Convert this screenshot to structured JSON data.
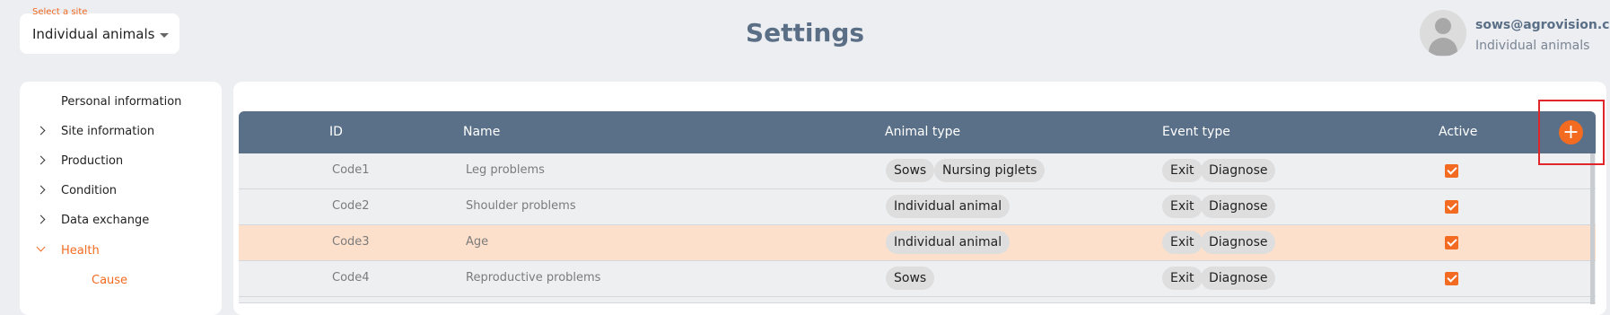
{
  "site_selector": {
    "label": "Select a site",
    "value": "Individual animals"
  },
  "page_title": "Settings",
  "user": {
    "email": "sows@agrovision.com",
    "site": "Individual animals"
  },
  "sidebar": {
    "items": [
      {
        "label": "Personal information",
        "expandable": false
      },
      {
        "label": "Site information",
        "expandable": true
      },
      {
        "label": "Production",
        "expandable": true
      },
      {
        "label": "Condition",
        "expandable": true
      },
      {
        "label": "Data exchange",
        "expandable": true
      },
      {
        "label": "Health",
        "expandable": true,
        "expanded": true,
        "active": true
      }
    ],
    "sub_item": "Cause"
  },
  "table": {
    "headers": {
      "id": "ID",
      "name": "Name",
      "animal_type": "Animal type",
      "event_type": "Event type",
      "active": "Active"
    },
    "rows": [
      {
        "id": "Code1",
        "name": "Leg problems",
        "animal_types": [
          "Sows",
          "Nursing piglets"
        ],
        "event_types": [
          "Exit",
          "Diagnose"
        ],
        "active": true
      },
      {
        "id": "Code2",
        "name": "Shoulder problems",
        "animal_types": [
          "Individual animal"
        ],
        "event_types": [
          "Exit",
          "Diagnose"
        ],
        "active": true
      },
      {
        "id": "Code3",
        "name": "Age",
        "animal_types": [
          "Individual animal"
        ],
        "event_types": [
          "Exit",
          "Diagnose"
        ],
        "active": true,
        "highlighted": true
      },
      {
        "id": "Code4",
        "name": "Reproductive problems",
        "animal_types": [
          "Sows"
        ],
        "event_types": [
          "Exit",
          "Diagnose"
        ],
        "active": true
      }
    ]
  },
  "add_button": {
    "label": "+",
    "icon": "plus-icon"
  },
  "colors": {
    "accent": "#f26b21",
    "header": "#5a7088",
    "highlight_row": "#fde0cc",
    "title": "#5a6f86"
  }
}
